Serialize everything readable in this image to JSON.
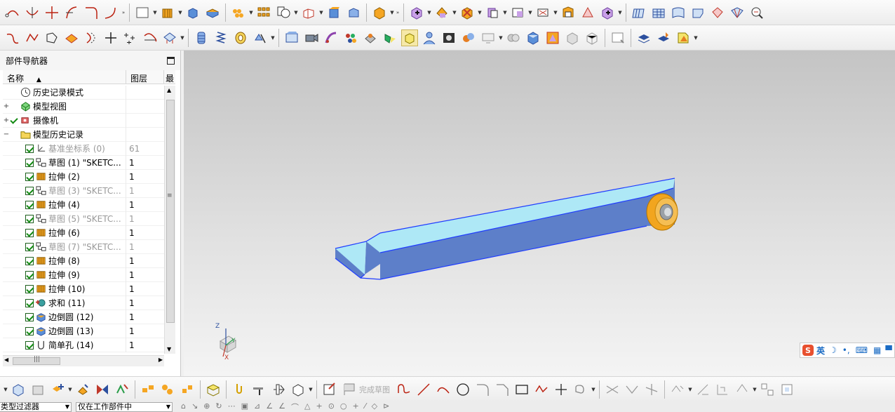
{
  "navigator": {
    "title": "部件导航器",
    "col_name": "名称",
    "col_layer": "图层",
    "col_extra": "最",
    "rows": [
      {
        "name": "历史记录模式",
        "layer": "",
        "dim": false
      },
      {
        "name": "模型视图",
        "layer": "",
        "dim": false
      },
      {
        "name": "摄像机",
        "layer": "",
        "dim": false
      },
      {
        "name": "模型历史记录",
        "layer": "",
        "dim": false
      },
      {
        "name": "基准坐标系 (0)",
        "layer": "61",
        "dim": true
      },
      {
        "name": "草图 (1) \"SKETC...",
        "layer": "1",
        "dim": false
      },
      {
        "name": "拉伸 (2)",
        "layer": "1",
        "dim": false
      },
      {
        "name": "草图 (3) \"SKETC...",
        "layer": "1",
        "dim": true
      },
      {
        "name": "拉伸 (4)",
        "layer": "1",
        "dim": false
      },
      {
        "name": "草图 (5) \"SKETC...",
        "layer": "1",
        "dim": true
      },
      {
        "name": "拉伸 (6)",
        "layer": "1",
        "dim": false
      },
      {
        "name": "草图 (7) \"SKETC...",
        "layer": "1",
        "dim": true
      },
      {
        "name": "拉伸 (8)",
        "layer": "1",
        "dim": false
      },
      {
        "name": "拉伸 (9)",
        "layer": "1",
        "dim": false
      },
      {
        "name": "拉伸 (10)",
        "layer": "1",
        "dim": false
      },
      {
        "name": "求和 (11)",
        "layer": "1",
        "dim": false
      },
      {
        "name": "边倒圆 (12)",
        "layer": "1",
        "dim": false
      },
      {
        "name": "边倒圆 (13)",
        "layer": "1",
        "dim": false
      },
      {
        "name": "简单孔 (14)",
        "layer": "1",
        "dim": false
      }
    ]
  },
  "viewport": {
    "axis_z": "Z",
    "axis_y": "Y",
    "axis_x": "X"
  },
  "ime": {
    "label": "英"
  },
  "sketch_toolbar": {
    "finish_sketch": "完成草图"
  },
  "bottom_bar": {
    "filter_value": "类型过滤器",
    "scope_value": "仅在工作部件中"
  },
  "colors": {
    "part_top": "#aee8f6",
    "part_side": "#5d7fc9",
    "part_edge": "#1f3cff",
    "bushing": "#f2a51e",
    "viewport_top": "#c4c4c4",
    "viewport_bottom": "#f4f4f4"
  }
}
